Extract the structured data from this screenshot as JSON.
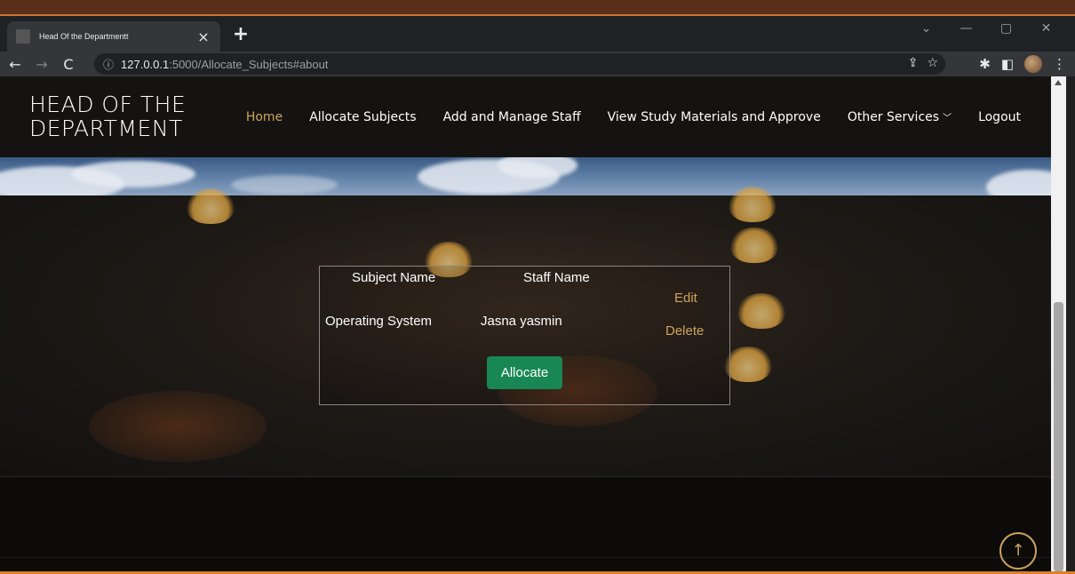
{
  "browser": {
    "tab_title": "Head Of the Departmentt",
    "tab_close": "×",
    "new_tab": "+",
    "url_host": "127.0.0.1",
    "url_rest": ":5000/Allocate_Subjects#about",
    "window_controls": [
      "⌄",
      "—",
      "▢",
      "✕"
    ]
  },
  "header": {
    "logo_line1": "HEAD OF THE",
    "logo_line2": "DEPARTMENT",
    "nav": [
      {
        "label": "Home",
        "active": true
      },
      {
        "label": "Allocate Subjects"
      },
      {
        "label": "Add and Manage Staff"
      },
      {
        "label": "View Study Materials and Approve"
      },
      {
        "label": "Other Services"
      },
      {
        "label": "Logout"
      }
    ]
  },
  "allocation": {
    "col_subject": "Subject Name",
    "col_staff": "Staff Name",
    "rows": [
      {
        "subject": "Operating System",
        "staff": "Jasna yasmin",
        "edit": "Edit",
        "delete": "Delete"
      }
    ],
    "allocate_label": "Allocate"
  },
  "back_to_top": "↑",
  "colors": {
    "accent": "#cda45e",
    "button": "#198754"
  }
}
